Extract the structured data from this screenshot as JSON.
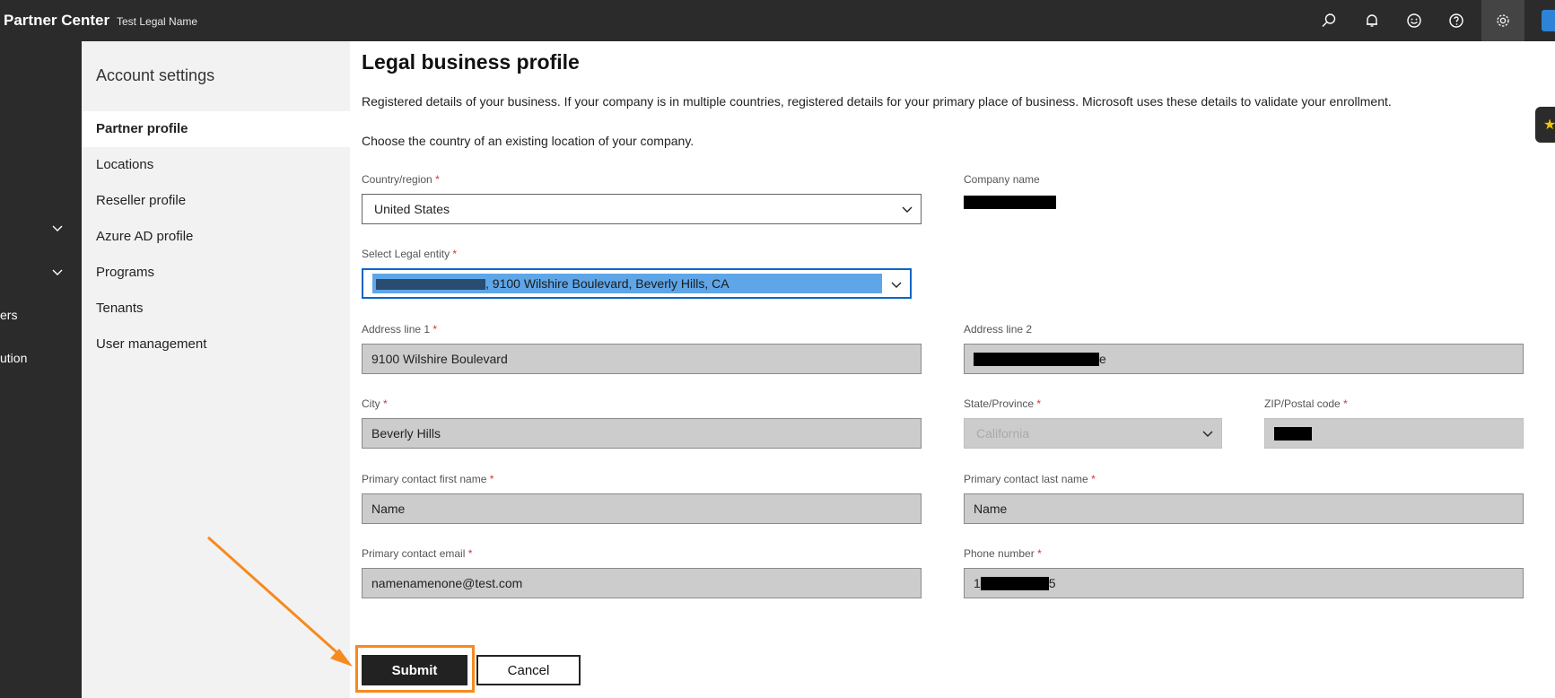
{
  "header": {
    "brand": "Partner Center",
    "tenant": "Test Legal Name",
    "icons": [
      "search-icon",
      "bell-icon",
      "smiley-icon",
      "help-icon",
      "gear-icon",
      "avatar-icon"
    ]
  },
  "rail": {
    "items": [
      {
        "text": "ers"
      },
      {
        "text": "ution"
      }
    ]
  },
  "nav": {
    "title": "Account settings",
    "items": [
      {
        "label": "Partner profile",
        "selected": true
      },
      {
        "label": "Locations"
      },
      {
        "label": "Reseller profile"
      },
      {
        "label": "Azure AD profile"
      },
      {
        "label": "Programs"
      },
      {
        "label": "Tenants"
      },
      {
        "label": "User management"
      }
    ]
  },
  "page": {
    "title": "Legal business profile",
    "description": "Registered details of your business. If your company is in multiple countries, registered details for your primary place of business. Microsoft uses these details to validate your enrollment.",
    "instruction": "Choose the country of an existing location of your company."
  },
  "form": {
    "required_mark": "*",
    "country": {
      "label": "Country/region",
      "value": "United States"
    },
    "company_name": {
      "label": "Company name"
    },
    "legal_entity": {
      "label": "Select Legal entity",
      "value_visible": ", 9100 Wilshire Boulevard, Beverly Hills, CA"
    },
    "address1": {
      "label": "Address line 1",
      "value": "9100 Wilshire Boulevard"
    },
    "address2": {
      "label": "Address line 2",
      "value_suffix": "e"
    },
    "city": {
      "label": "City",
      "value": "Beverly Hills"
    },
    "state": {
      "label": "State/Province",
      "value": "California"
    },
    "zip": {
      "label": "ZIP/Postal code"
    },
    "first_name": {
      "label": "Primary contact first name",
      "value": "Name"
    },
    "last_name": {
      "label": "Primary contact last name",
      "value": "Name"
    },
    "email": {
      "label": "Primary contact email",
      "value": "namenamenone@test.com"
    },
    "phone": {
      "label": "Phone number",
      "value_prefix": "1",
      "value_suffix": "5"
    }
  },
  "actions": {
    "submit": "Submit",
    "cancel": "Cancel"
  },
  "colors": {
    "accent_highlight": "#f7891e",
    "selection": "#5ea6e8",
    "required": "#d13438"
  }
}
